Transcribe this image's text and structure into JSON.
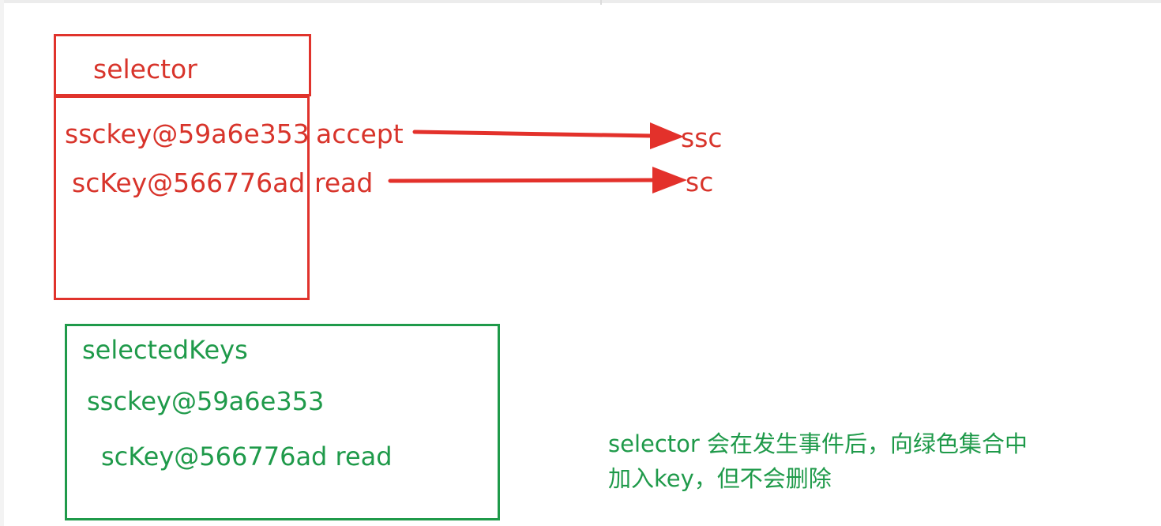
{
  "selector": {
    "title": "selector",
    "keys": [
      {
        "key": "ssckey@59a6e353",
        "event": "accept",
        "target": "ssc"
      },
      {
        "key": "scKey@566776ad",
        "event": "read",
        "target": "sc"
      }
    ]
  },
  "selected_keys": {
    "title": "selectedKeys",
    "items": [
      "ssckey@59a6e353",
      "scKey@566776ad read"
    ]
  },
  "note": {
    "line1": "selector 会在发生事件后，向绿色集合中",
    "line2": "加入key，但不会删除"
  },
  "colors": {
    "selector": "#e0332c",
    "selected_keys": "#1f9a4a"
  }
}
